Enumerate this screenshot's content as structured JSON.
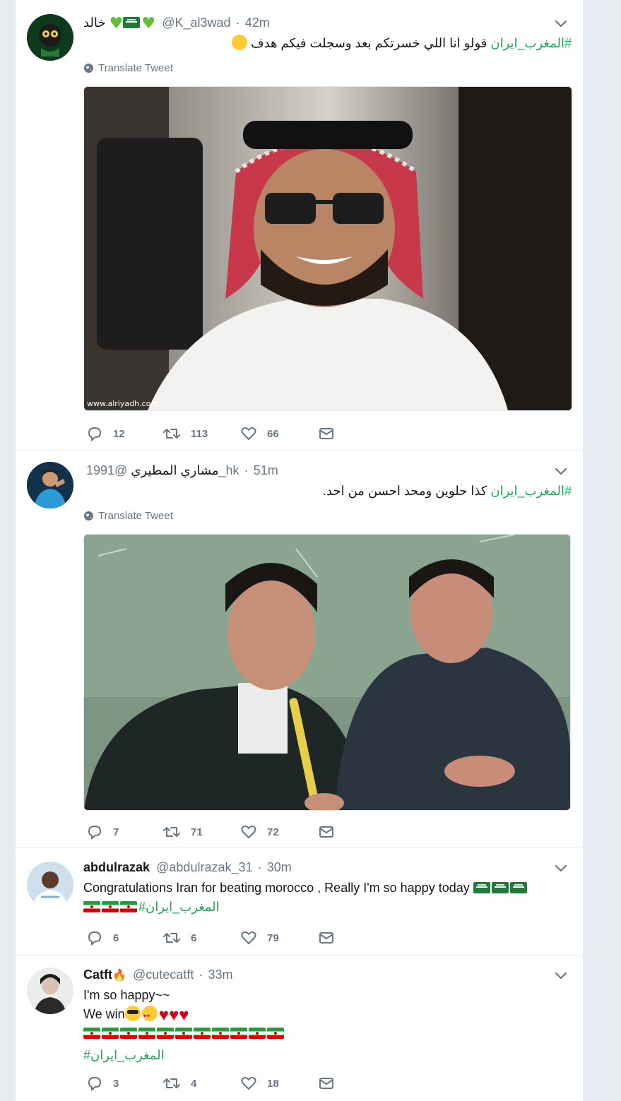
{
  "tweets": [
    {
      "display_name": "خالد",
      "handle": "@K_al3wad",
      "time": "42m",
      "hashtag": "#المغرب_ايران",
      "text": " قولو انا اللي خسرتكم بعد وسجلت فيكم هدف",
      "translate": "Translate Tweet",
      "media_caption": "www.alriyadh.com",
      "replies": "12",
      "retweets": "113",
      "likes": "66"
    },
    {
      "display_name": "مشاري المطيري",
      "handle": "@1991_hk",
      "time": "51m",
      "hashtag": "#المغرب_ايران",
      "text": " كذا حلوين ومحد احسن من احد.",
      "translate": "Translate Tweet",
      "replies": "7",
      "retweets": "71",
      "likes": "72"
    },
    {
      "display_name": "abdulrazak",
      "handle": "@abdulrazak_31",
      "time": "30m",
      "text": "Congratulations Iran for beating morocco , Really I'm so happy today",
      "hashtag": "#المغرب_ايران",
      "replies": "6",
      "retweets": "6",
      "likes": "79"
    },
    {
      "display_name": "Catft",
      "handle": "@cutecatft",
      "time": "33m",
      "line1": "I'm so happy~~",
      "line2": "We win",
      "hashtag": "#المغرب_ايران",
      "replies": "3",
      "retweets": "4",
      "likes": "18"
    }
  ],
  "colors": {
    "hashtag": "#1da75a",
    "muted": "#657786",
    "background": "#e6ecf0"
  },
  "icons": [
    "reply-icon",
    "retweet-icon",
    "like-icon",
    "dm-icon",
    "globe-icon",
    "chevron-down-icon"
  ]
}
